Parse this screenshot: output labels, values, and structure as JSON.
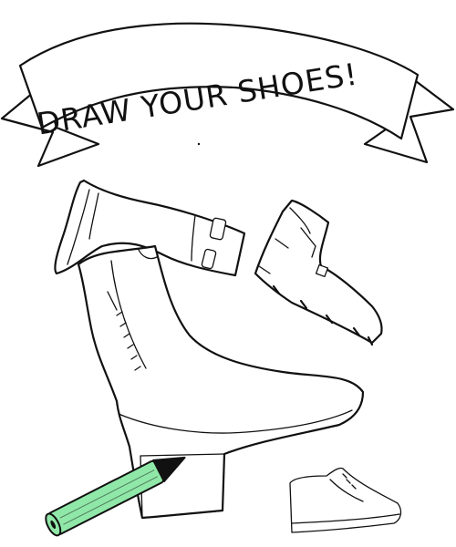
{
  "banner": {
    "title": "DRAW YOUR SHOES!"
  },
  "colors": {
    "ink": "#111111",
    "background": "#ffffff",
    "pencil_body": "#90e8a8",
    "pencil_tip": "#111111"
  },
  "icons": {
    "banner": "ribbon-banner-icon",
    "rain_boot": "rain-boot-icon",
    "ski_boot": "ski-boot-icon",
    "ankle_boot": "ankle-boot-icon",
    "sneaker": "sneaker-icon",
    "pencil": "pencil-icon"
  }
}
